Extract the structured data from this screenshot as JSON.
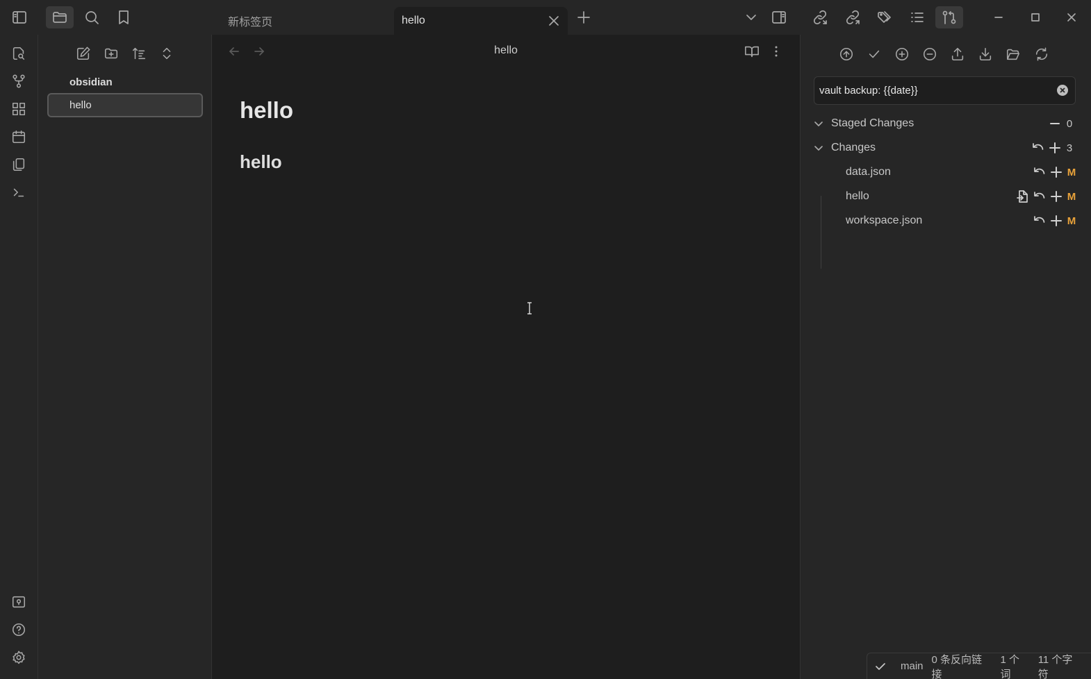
{
  "tabs": [
    {
      "label": "新标签页",
      "active": false
    },
    {
      "label": "hello",
      "active": true
    }
  ],
  "explorer": {
    "vault_name": "obsidian",
    "files": [
      {
        "label": "hello",
        "selected": true
      }
    ]
  },
  "editor": {
    "view_title": "hello",
    "heading1": "hello",
    "heading2": "hello"
  },
  "git": {
    "commit_message": "vault backup: {{date}}",
    "staged": {
      "label": "Staged Changes",
      "count": "0"
    },
    "changes": {
      "label": "Changes",
      "count": "3"
    },
    "files": [
      {
        "name": "data.json",
        "status": "M"
      },
      {
        "name": "hello",
        "status": "M"
      },
      {
        "name": "workspace.json",
        "status": "M"
      }
    ],
    "status_color": "#e8a23a"
  },
  "statusbar": {
    "branch": "main",
    "backlinks": "0 条反向链接",
    "words": "1 个词",
    "chars": "11 个字符"
  }
}
